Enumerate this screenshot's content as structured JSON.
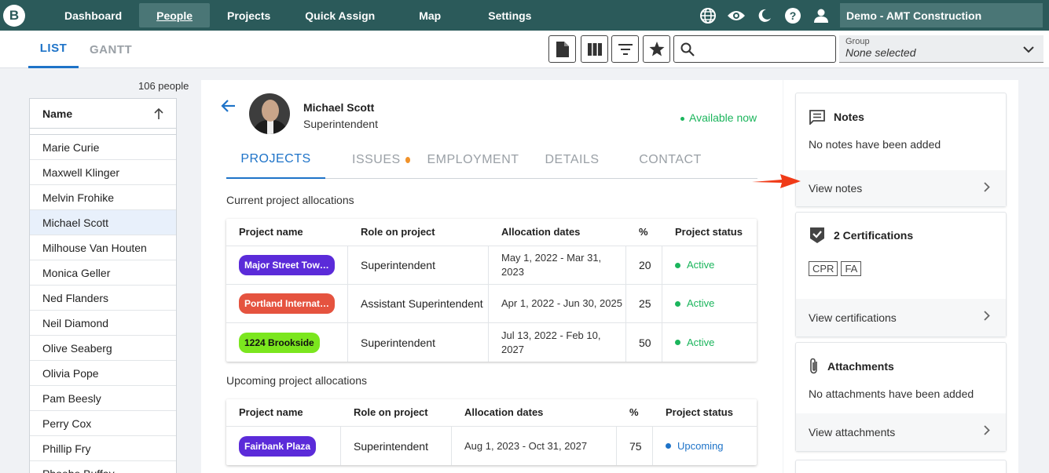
{
  "nav": {
    "logo_letter": "B",
    "items": [
      {
        "label": "Dashboard"
      },
      {
        "label": "People"
      },
      {
        "label": "Projects"
      },
      {
        "label": "Quick Assign"
      },
      {
        "label": "Map"
      },
      {
        "label": "Settings"
      }
    ],
    "active_index": 1,
    "org_name": "Demo - AMT Construction"
  },
  "subbar": {
    "tab_list": "LIST",
    "tab_gantt": "GANTT",
    "search": {
      "value": "",
      "placeholder": ""
    },
    "group_label": "Group",
    "group_value": "None selected"
  },
  "people": {
    "count_text": "106 people",
    "column_header": "Name",
    "items": [
      {
        "name": "Marie Curie"
      },
      {
        "name": "Maxwell Klinger"
      },
      {
        "name": "Melvin Frohike"
      },
      {
        "name": "Michael Scott"
      },
      {
        "name": "Milhouse Van Houten"
      },
      {
        "name": "Monica Geller"
      },
      {
        "name": "Ned Flanders"
      },
      {
        "name": "Neil Diamond"
      },
      {
        "name": "Olive Seaberg"
      },
      {
        "name": "Olivia Pope"
      },
      {
        "name": "Pam Beesly"
      },
      {
        "name": "Perry Cox"
      },
      {
        "name": "Phillip Fry"
      },
      {
        "name": "Phoebe Buffay"
      }
    ],
    "selected_index": 3
  },
  "person": {
    "name": "Michael Scott",
    "role": "Superintendent",
    "availability": "Available now"
  },
  "tabs": [
    {
      "label": "PROJECTS"
    },
    {
      "label": "ISSUES"
    },
    {
      "label": "EMPLOYMENT"
    },
    {
      "label": "DETAILS"
    },
    {
      "label": "CONTACT"
    }
  ],
  "current": {
    "title": "Current project allocations",
    "headers": [
      "Project name",
      "Role on project",
      "Allocation dates",
      "%",
      "Project status"
    ],
    "rows": [
      {
        "project": "Major Street Tow…",
        "color": "#5b2bd9",
        "role": "Superintendent",
        "dates": "May 1, 2022 - Mar 31, 2023",
        "pct": "20",
        "status": "Active"
      },
      {
        "project": "Portland Internat…",
        "color": "#e5533f",
        "role": "Assistant Superintendent",
        "dates": "Apr 1, 2022 - Jun 30, 2025",
        "pct": "25",
        "status": "Active"
      },
      {
        "project": "1224 Brookside",
        "color": "#7be61e",
        "role": "Superintendent",
        "dates": "Jul 13, 2022 - Feb 10, 2027",
        "pct": "50",
        "status": "Active"
      }
    ]
  },
  "upcoming": {
    "title": "Upcoming project allocations",
    "headers": [
      "Project name",
      "Role on project",
      "Allocation dates",
      "%",
      "Project status"
    ],
    "rows": [
      {
        "project": "Fairbank Plaza",
        "color": "#5b2bd9",
        "role": "Superintendent",
        "dates": "Aug 1, 2023 - Oct 31, 2027",
        "pct": "75",
        "status": "Upcoming"
      }
    ]
  },
  "colors": {
    "active": "#1bb55c",
    "upcoming": "#1e73c8",
    "accent": "#1e73c8",
    "nav_bg": "#2b5a5a"
  },
  "cards": {
    "notes": {
      "title": "Notes",
      "text": "No notes have been added",
      "link": "View notes"
    },
    "certs": {
      "title": "2 Certifications",
      "badges": [
        "CPR",
        "FA"
      ],
      "link": "View certifications"
    },
    "attachments": {
      "title": "Attachments",
      "text": "No attachments have been added",
      "link": "View attachments"
    }
  }
}
